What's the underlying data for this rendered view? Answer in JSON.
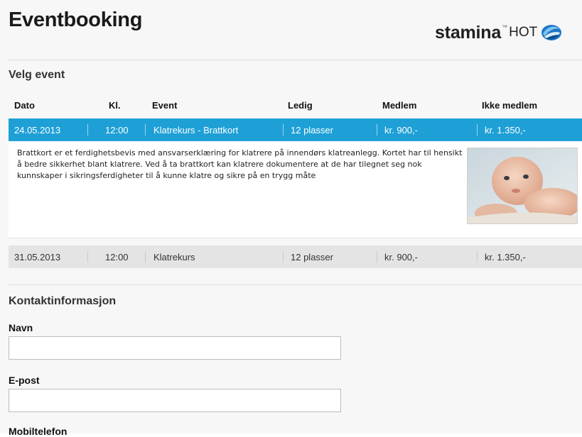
{
  "header": {
    "title": "Eventbooking",
    "logo_main": "stamina",
    "logo_tm": "™",
    "logo_hot": "HOT"
  },
  "events_section": {
    "title": "Velg event",
    "columns": [
      "Dato",
      "Kl.",
      "Event",
      "Ledig",
      "Medlem",
      "Ikke medlem"
    ],
    "rows": [
      {
        "date": "24.05.2013",
        "time": "12:00",
        "event": "Klatrekurs - Brattkort",
        "available": "12 plasser",
        "member_price": "kr. 900,-",
        "non_member_price": "kr. 1.350,-",
        "selected": true,
        "description": "Brattkort er et ferdighetsbevis med ansvarserklæring for klatrere på innendørs klatreanlegg. Kortet har til hensikt å bedre sikkerhet blant klatrere. Ved å ta brattkort kan klatrere dokumentere at de har tilegnet seg nok kunnskaper i sikringsferdigheter til å kunne klatre og sikre på en trygg måte"
      },
      {
        "date": "31.05.2013",
        "time": "12:00",
        "event": "Klatrekurs",
        "available": "12 plasser",
        "member_price": "kr. 900,-",
        "non_member_price": "kr. 1.350,-",
        "selected": false
      }
    ]
  },
  "contact_section": {
    "title": "Kontaktinformasjon",
    "name_label": "Navn",
    "name_value": "",
    "email_label": "E-post",
    "email_value": "",
    "phone_label": "Mobiltelefon"
  },
  "colors": {
    "accent": "#1ea0d6",
    "row_gray": "#e4e4e4",
    "background": "#f7f7f7"
  },
  "icons": {
    "logo_icon": "stamina-swirl-icon",
    "event_image": "baby-photo"
  }
}
